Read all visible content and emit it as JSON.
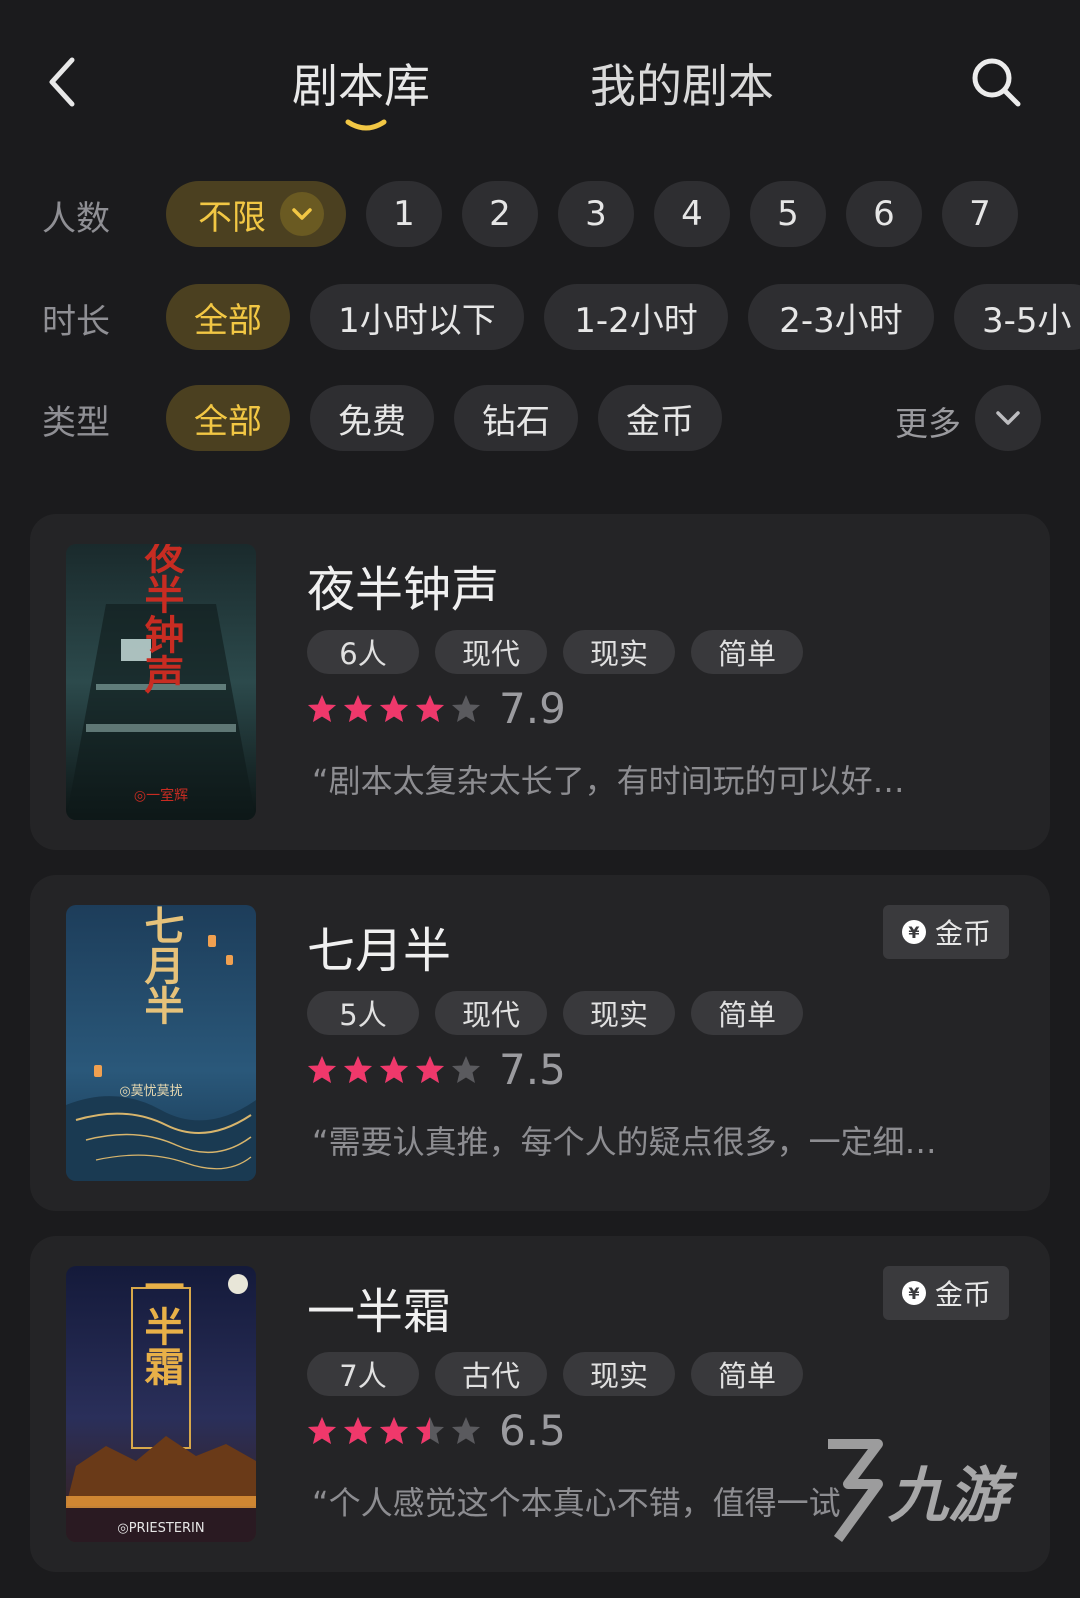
{
  "header": {
    "tabs": [
      {
        "label": "剧本库",
        "active": true
      },
      {
        "label": "我的剧本",
        "active": false
      }
    ],
    "back_icon": "chevron-left-icon",
    "search_icon": "search-icon"
  },
  "filters": {
    "count": {
      "label": "人数",
      "selected": "不限",
      "options": [
        "1",
        "2",
        "3",
        "4",
        "5",
        "6",
        "7"
      ]
    },
    "duration": {
      "label": "时长",
      "options": [
        "全部",
        "1小时以下",
        "1-2小时",
        "2-3小时",
        "3-5小"
      ]
    },
    "type": {
      "label": "类型",
      "options": [
        "全部",
        "免费",
        "钻石",
        "金币"
      ],
      "more_label": "更多"
    }
  },
  "scripts": [
    {
      "title": "夜半钟声",
      "tags": [
        "6人",
        "现代",
        "现实",
        "简单"
      ],
      "stars": 4,
      "score": "7.9",
      "review": "“剧本太复杂太长了，有时间玩的可以好…",
      "badge": null,
      "cover_title": "夜半钟声",
      "cover_author": "◎一室辉"
    },
    {
      "title": "七月半",
      "tags": [
        "5人",
        "现代",
        "现实",
        "简单"
      ],
      "stars": 4,
      "score": "7.5",
      "review": "“需要认真推，每个人的疑点很多，一定细…",
      "badge": "金币",
      "cover_title": "七月半",
      "cover_author": "◎莫忧莫扰"
    },
    {
      "title": "一半霜",
      "tags": [
        "7人",
        "古代",
        "现实",
        "简单"
      ],
      "stars": 3.5,
      "score": "6.5",
      "review": "“个人感觉这个本真心不错，值得一试",
      "badge": "金币",
      "cover_title": "一半霜",
      "cover_author": "◎PRIESTERIN"
    }
  ],
  "watermark": "九游",
  "colors": {
    "background": "#1b1b1d",
    "card": "#242426",
    "accent_gold": "#f2c744",
    "star_pink": "#f0386b",
    "star_empty": "#5a5a5e"
  }
}
